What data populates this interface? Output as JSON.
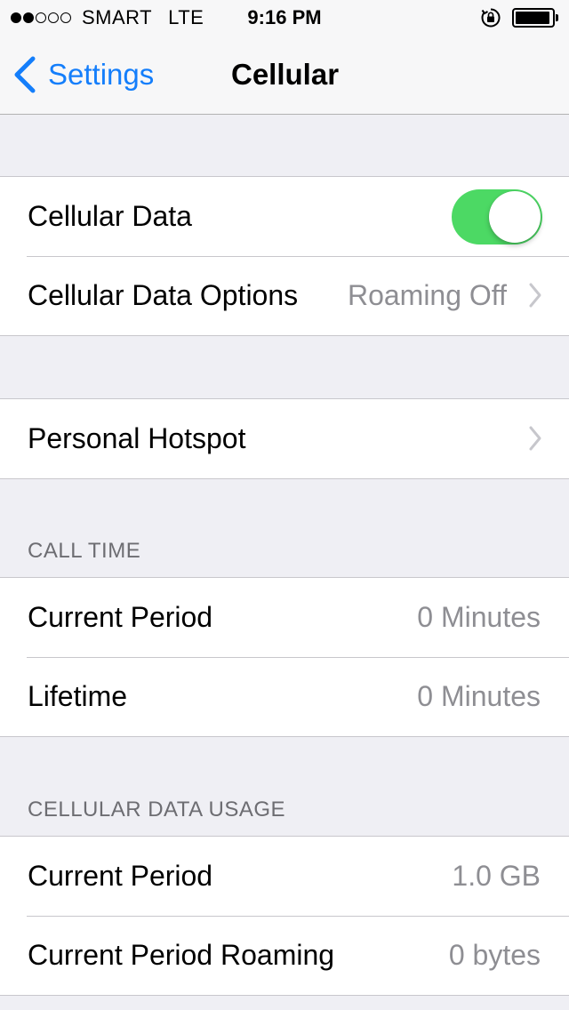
{
  "status_bar": {
    "signal_dots_filled": 2,
    "signal_dots_total": 5,
    "carrier": "SMART",
    "network": "LTE",
    "time": "9:16 PM",
    "battery_level": 0.95,
    "icons": [
      "signal-dots-icon",
      "rotation-lock-icon",
      "battery-icon"
    ]
  },
  "nav": {
    "back_label": "Settings",
    "title": "Cellular"
  },
  "groups": {
    "data": {
      "cellular_data_label": "Cellular Data",
      "cellular_data_on": true,
      "options_label": "Cellular Data Options",
      "options_value": "Roaming Off"
    },
    "hotspot": {
      "label": "Personal Hotspot"
    },
    "call_time": {
      "header": "CALL TIME",
      "rows": [
        {
          "label": "Current Period",
          "value": "0 Minutes"
        },
        {
          "label": "Lifetime",
          "value": "0 Minutes"
        }
      ]
    },
    "data_usage": {
      "header": "CELLULAR DATA USAGE",
      "rows": [
        {
          "label": "Current Period",
          "value": "1.0 GB"
        },
        {
          "label": "Current Period Roaming",
          "value": "0 bytes"
        }
      ]
    }
  },
  "colors": {
    "accent": "#147efb",
    "toggle_on": "#4cd964",
    "background": "#efeff4",
    "secondary_text": "#8e8e93"
  }
}
